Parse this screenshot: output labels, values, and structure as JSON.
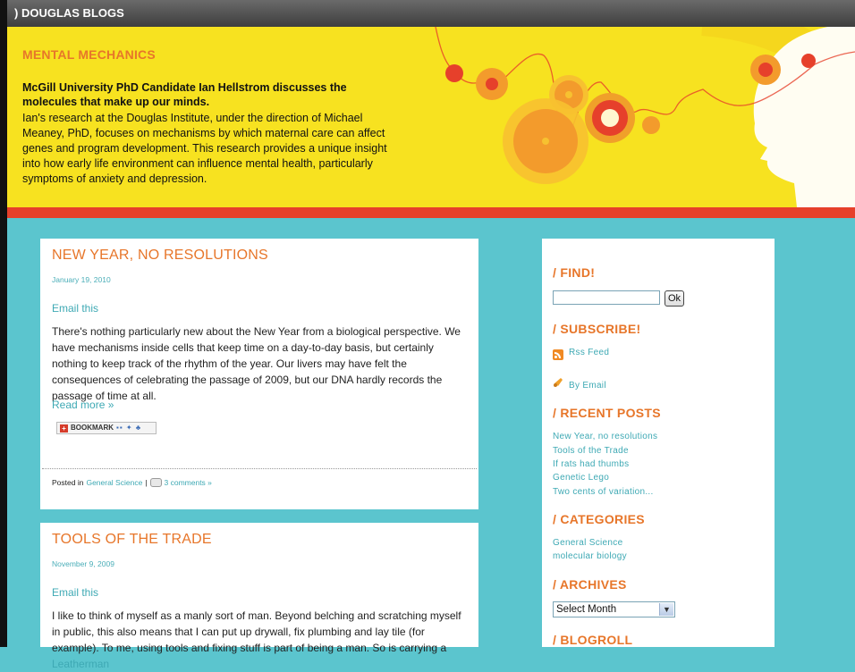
{
  "topbar": {
    "title": ") DOUGLAS BLOGS"
  },
  "header": {
    "site_title": "MENTAL MECHANICS",
    "tagline_bold": "McGill University PhD Candidate Ian Hellstrom discusses the molecules that make up our minds.",
    "tagline_body": "Ian's research at the Douglas Institute, under the direction of Michael Meaney, PhD, focuses on mechanisms by which maternal care can affect genes and program development. This research provides a unique insight into how early life environment can influence mental health, particularly symptoms of anxiety and depression."
  },
  "posts": [
    {
      "title": "NEW YEAR, NO RESOLUTIONS",
      "date": "January 19, 2010",
      "email_label": "Email this",
      "body": "There's nothing particularly new about the New Year from a biological perspective. We have mechanisms inside cells that keep time on a day-to-day basis, but certainly nothing to keep track of the rhythm of the year. Our livers may have felt the consequences of celebrating the passage of 2009, but our DNA hardly records the passage of time at all.",
      "read_more": "Read more »",
      "bookmark_label": "BOOKMARK",
      "posted_in": "Posted in",
      "category": "General Science",
      "separator": "|",
      "comments": "3 comments »"
    },
    {
      "title": "TOOLS OF THE TRADE",
      "date": "November 9, 2009",
      "email_label": "Email this",
      "body_start": "I like to think of myself as a manly sort of man. Beyond belching and scratching myself in public, this also means that I can put up drywall, fix plumbing and lay tile (for example). To me, using tools and fixing stuff is part of being a man. So is carrying a",
      "body_link": "Leatherman"
    }
  ],
  "sidebar": {
    "find_heading": "/ FIND!",
    "search_value": "",
    "ok_label": "Ok",
    "subscribe_heading": "/ SUBSCRIBE!",
    "rss_label": "Rss Feed",
    "email_label": "By Email",
    "recent_heading": "/ RECENT POSTS",
    "recent_posts": [
      "New Year, no resolutions",
      "Tools of the Trade",
      "If rats had thumbs",
      "Genetic Lego",
      "Two cents of variation..."
    ],
    "categories_heading": "/ CATEGORIES",
    "categories": [
      "General Science",
      "molecular biology"
    ],
    "archives_heading": "/ ARCHIVES",
    "archives_selected": "Select Month",
    "blogroll_heading": "/ BLOGROLL"
  },
  "colors": {
    "accent_orange": "#e7762a",
    "link_teal": "#3ea9b4",
    "background_teal": "#5bc5ce",
    "header_yellow": "#f7e220",
    "band_red": "#e6402b"
  },
  "icons": [
    "rss-icon",
    "email-bell-icon",
    "comment-icon",
    "dropdown-arrow-icon"
  ]
}
